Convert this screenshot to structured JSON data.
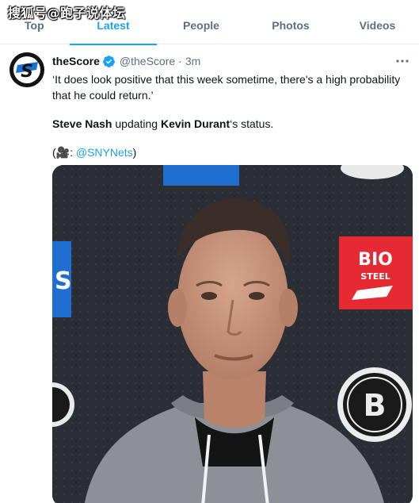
{
  "watermark": {
    "text": "搜狐号@跑子说体坛"
  },
  "tabs": [
    {
      "label": "Top",
      "active": false
    },
    {
      "label": "Latest",
      "active": true
    },
    {
      "label": "People",
      "active": false
    },
    {
      "label": "Photos",
      "active": false
    },
    {
      "label": "Videos",
      "active": false
    }
  ],
  "tweet": {
    "avatar_letter": "S",
    "display_name": "theScore",
    "handle": "@theScore",
    "separator": "·",
    "time": "3m",
    "quote": "‘It does look positive that this week sometime, there's a high probability that he could return.’",
    "person_1": "Steve Nash",
    "middle_text": " updating ",
    "person_2": "Kevin Durant",
    "end_text": "‘s status.",
    "credit_open": "(🎥: ",
    "credit_mention": "@SNYNets",
    "credit_close": ")",
    "media": {
      "sponsor_line_1": "BIO",
      "sponsor_line_2": "STEEL",
      "team_letter": "B",
      "left_banner_letter": "S"
    }
  },
  "colors": {
    "accent": "#1da1f2",
    "secondary_text": "#5b7083",
    "backdrop": "#2a2d33",
    "sponsor_red": "#e52a34",
    "banner_blue": "#1f6fd1"
  },
  "icons": {
    "verified": "verified-badge-icon",
    "more": "more-options-icon",
    "camera": "movie-camera-icon"
  }
}
